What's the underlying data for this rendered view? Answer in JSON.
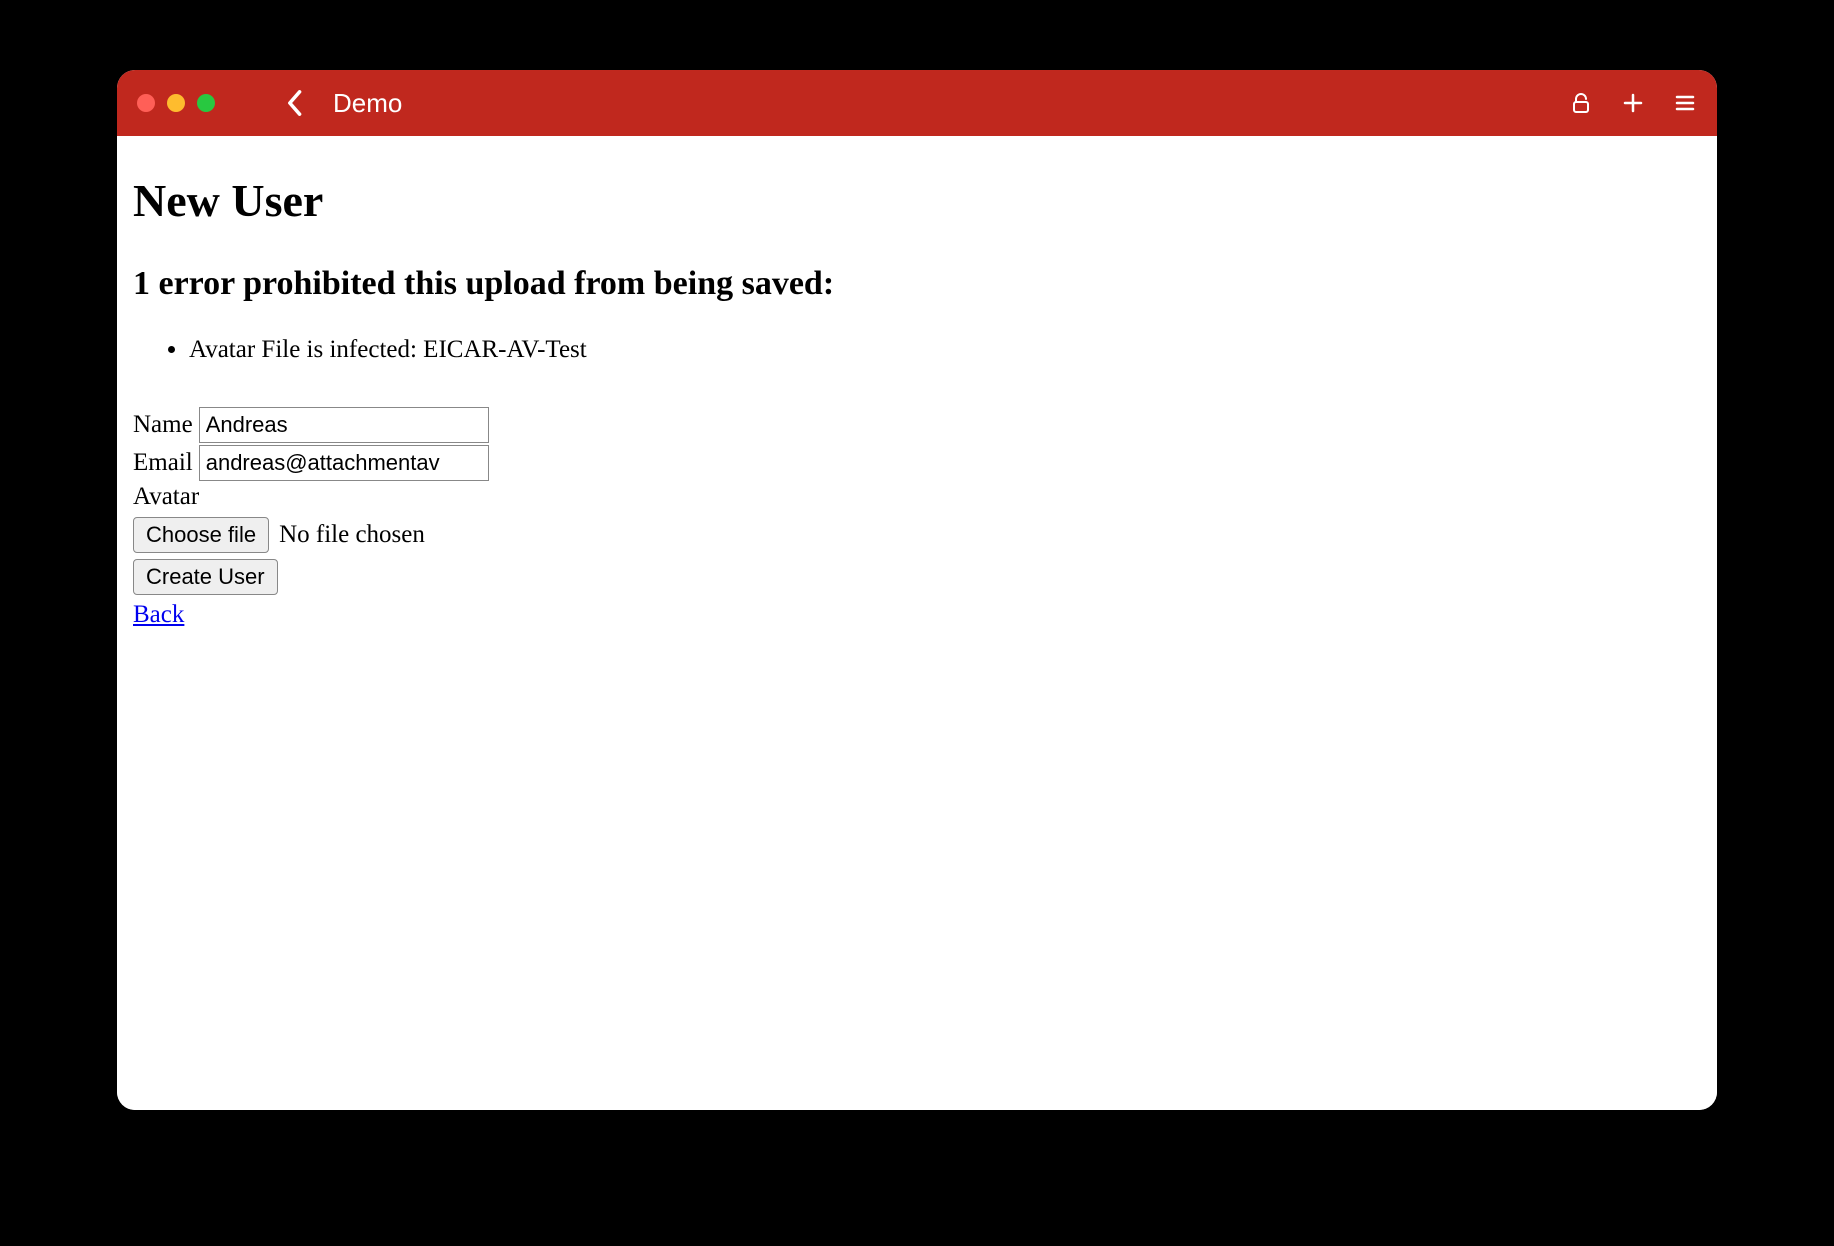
{
  "window": {
    "title": "Demo"
  },
  "page": {
    "heading": "New User",
    "error_heading": "1 error prohibited this upload from being saved:",
    "errors": [
      "Avatar File is infected: EICAR-AV-Test"
    ]
  },
  "form": {
    "name_label": "Name",
    "name_value": "Andreas",
    "email_label": "Email",
    "email_value": "andreas@attachmentav",
    "avatar_label": "Avatar",
    "choose_file_label": "Choose file",
    "file_status": "No file chosen",
    "submit_label": "Create User",
    "back_label": "Back"
  }
}
